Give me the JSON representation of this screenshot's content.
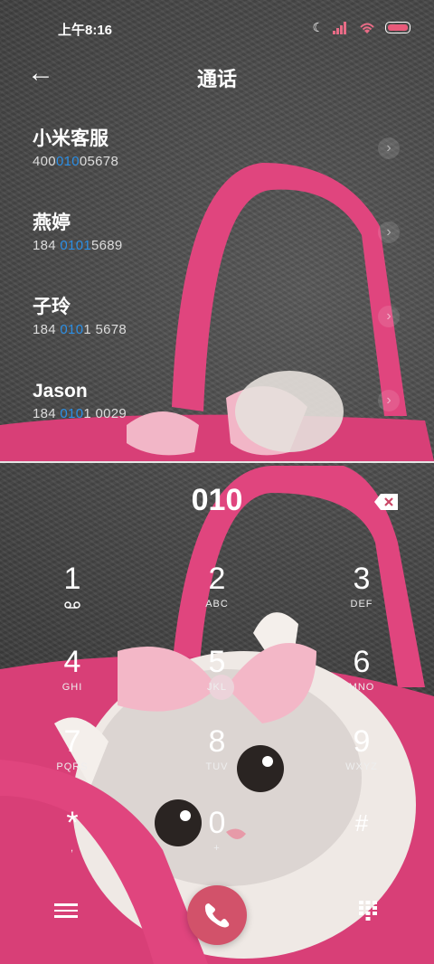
{
  "status": {
    "time": "上午8:16",
    "icons": [
      "moon-icon",
      "signal-icon",
      "wifi-icon",
      "battery-icon"
    ]
  },
  "header": {
    "title": "通话",
    "back_icon": "arrow-left-icon"
  },
  "results": [
    {
      "name": "小米客服",
      "num_before": "400",
      "num_match": "010",
      "num_after": "05678"
    },
    {
      "name": "燕婷",
      "num_before": "184 ",
      "num_match": "0101",
      "num_after": "5689"
    },
    {
      "name": "子玲",
      "num_before": "184 ",
      "num_match": "010",
      "num_after": "1 5678"
    },
    {
      "name": "Jason",
      "num_before": "184 ",
      "num_match": "010",
      "num_after": "1 0029"
    }
  ],
  "dialer": {
    "input": "010"
  },
  "keypad": [
    {
      "digit": "1",
      "letters": ""
    },
    {
      "digit": "2",
      "letters": "ABC"
    },
    {
      "digit": "3",
      "letters": "DEF"
    },
    {
      "digit": "4",
      "letters": "GHI"
    },
    {
      "digit": "5",
      "letters": "JKL"
    },
    {
      "digit": "6",
      "letters": "MNO"
    },
    {
      "digit": "7",
      "letters": "PQRS"
    },
    {
      "digit": "8",
      "letters": "TUV"
    },
    {
      "digit": "9",
      "letters": "WXYZ"
    },
    {
      "digit": "*",
      "letters": ","
    },
    {
      "digit": "0",
      "letters": "+"
    },
    {
      "digit": "#",
      "letters": ""
    }
  ],
  "colors": {
    "highlight": "#2b8fe6",
    "call_button": "#d2526a",
    "bag_pink": "#e0457e"
  }
}
